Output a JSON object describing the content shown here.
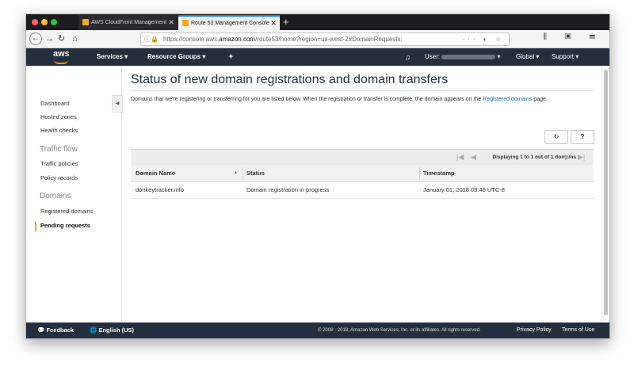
{
  "browser": {
    "tabs": [
      {
        "label": "AWS CloudFront Management",
        "active": false
      },
      {
        "label": "Route 53 Management Console",
        "active": true
      }
    ],
    "new_tab": "+",
    "close": "✕",
    "url_prefix": "https://console.aws.",
    "url_domain": "amazon.com",
    "url_suffix": "/route53/home?region=us-west-2#DomainRequests:",
    "url_actions": "··· ◐ ☆",
    "right_icons": "⫼ ▣ ☰"
  },
  "aws_header": {
    "logo": "aws",
    "services": "Services",
    "resource_groups": "Resource Groups",
    "pin": "✦",
    "bell": "🔔",
    "user": "User:",
    "region": "Global",
    "support": "Support",
    "caret": "▾"
  },
  "sidebar": {
    "items": [
      {
        "label": "Dashboard"
      },
      {
        "label": "Hosted zones"
      },
      {
        "label": "Health checks"
      }
    ],
    "section_traffic": "Traffic flow",
    "traffic_items": [
      {
        "label": "Traffic policies"
      },
      {
        "label": "Policy records"
      }
    ],
    "section_domains": "Domains",
    "domain_items": [
      {
        "label": "Registered domains"
      },
      {
        "label": "Pending requests",
        "active": true
      }
    ],
    "collapse": "◀"
  },
  "main": {
    "title": "Status of new domain registrations and domain transfers",
    "description": "Domains that we're registering or transferring for you are listed below. When the registration or transfer is complete, the domain appears on the",
    "description_link": "Registered domains",
    "description_end": "page.",
    "refresh_icon": "↻",
    "help_icon": "❓",
    "pager_text": "Displaying 1 to 1 out of 1 domains",
    "pager_first": "|◀",
    "pager_prev": "◀",
    "pager_next": "▶",
    "pager_last": "▶|",
    "columns": [
      "Domain Name",
      "Status",
      "Timestamp"
    ],
    "sort_icon": "▲",
    "rows": [
      {
        "domain": "donkeytracker.info",
        "status": "Domain registration in progress",
        "timestamp": "January 01, 2018 09:46 UTC-8"
      }
    ]
  },
  "footer": {
    "feedback": "Feedback",
    "language": "English (US)",
    "copyright": "© 2008 - 2018, Amazon Web Services, Inc. or its affiliates. All rights reserved.",
    "privacy": "Privacy Policy",
    "terms": "Terms of Use"
  },
  "colors": {
    "aws_bar": "#232f3e",
    "accent": "#ff9900",
    "link": "#1a6ec1"
  }
}
